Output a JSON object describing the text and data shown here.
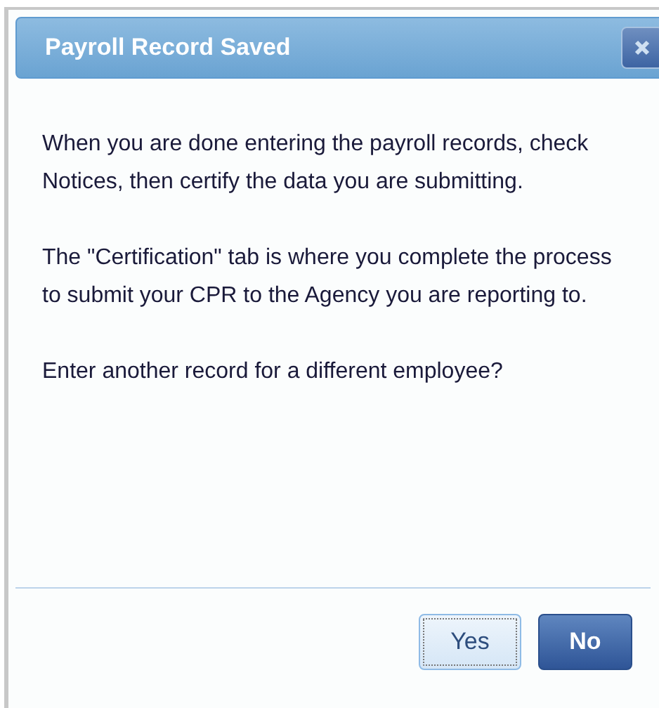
{
  "dialog": {
    "title": "Payroll Record Saved",
    "paragraphs": [
      "When you are done entering the payroll records, check Notices, then certify the data you are submitting.",
      "The \"Certification\" tab is where you complete the process to submit your CPR to the Agency you are reporting to.",
      "Enter another record for a different employee?"
    ],
    "buttons": [
      {
        "label": "Yes",
        "focused": true
      },
      {
        "label": "No",
        "focused": false
      }
    ]
  }
}
